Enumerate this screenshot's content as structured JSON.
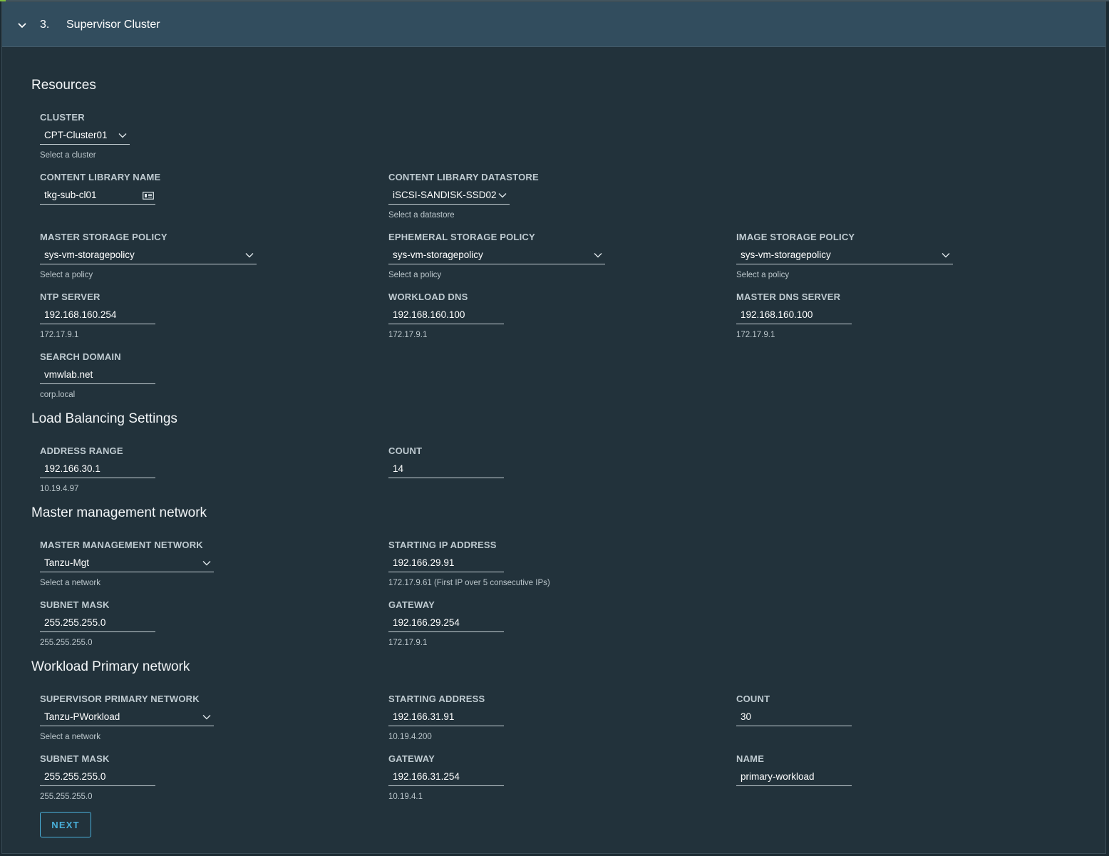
{
  "header": {
    "step": "3.",
    "title": "Supervisor Cluster"
  },
  "sections": {
    "resources": "Resources",
    "load_balancing": "Load Balancing Settings",
    "master_network": "Master management network",
    "workload_network": "Workload Primary network"
  },
  "fields": {
    "cluster": {
      "label": "CLUSTER",
      "value": "CPT-Cluster01",
      "help": "Select a cluster"
    },
    "content_library_name": {
      "label": "CONTENT LIBRARY NAME",
      "value": "tkg-sub-cl01"
    },
    "content_library_datastore": {
      "label": "CONTENT LIBRARY DATASTORE",
      "value": "iSCSI-SANDISK-SSD02",
      "help": "Select a datastore"
    },
    "master_storage_policy": {
      "label": "MASTER STORAGE POLICY",
      "value": "sys-vm-storagepolicy",
      "help": "Select a policy"
    },
    "ephemeral_storage_policy": {
      "label": "EPHEMERAL STORAGE POLICY",
      "value": "sys-vm-storagepolicy",
      "help": "Select a policy"
    },
    "image_storage_policy": {
      "label": "IMAGE STORAGE POLICY",
      "value": "sys-vm-storagepolicy",
      "help": "Select a policy"
    },
    "ntp_server": {
      "label": "NTP SERVER",
      "value": "192.168.160.254",
      "help": "172.17.9.1"
    },
    "workload_dns": {
      "label": "WORKLOAD DNS",
      "value": "192.168.160.100",
      "help": "172.17.9.1"
    },
    "master_dns_server": {
      "label": "MASTER DNS SERVER",
      "value": "192.168.160.100",
      "help": "172.17.9.1"
    },
    "search_domain": {
      "label": "SEARCH DOMAIN",
      "value": "vmwlab.net",
      "help": "corp.local"
    },
    "lb_address_range": {
      "label": "ADDRESS RANGE",
      "value": "192.166.30.1",
      "help": "10.19.4.97"
    },
    "lb_count": {
      "label": "COUNT",
      "value": "14"
    },
    "master_management_network": {
      "label": "MASTER MANAGEMENT NETWORK",
      "value": "Tanzu-Mgt",
      "help": "Select a network"
    },
    "master_starting_ip": {
      "label": "STARTING IP ADDRESS",
      "value": "192.166.29.91",
      "help": "172.17.9.61 (First IP over 5 consecutive IPs)"
    },
    "master_subnet_mask": {
      "label": "SUBNET MASK",
      "value": "255.255.255.0",
      "help": "255.255.255.0"
    },
    "master_gateway": {
      "label": "GATEWAY",
      "value": "192.166.29.254",
      "help": "172.17.9.1"
    },
    "supervisor_primary_network": {
      "label": "SUPERVISOR PRIMARY NETWORK",
      "value": "Tanzu-PWorkload",
      "help": "Select a network"
    },
    "workload_starting_address": {
      "label": "STARTING ADDRESS",
      "value": "192.166.31.91",
      "help": "10.19.4.200"
    },
    "workload_count": {
      "label": "COUNT",
      "value": "30"
    },
    "workload_subnet_mask": {
      "label": "SUBNET MASK",
      "value": "255.255.255.0",
      "help": "255.255.255.0"
    },
    "workload_gateway": {
      "label": "GATEWAY",
      "value": "192.166.31.254",
      "help": "10.19.4.1"
    },
    "workload_name": {
      "label": "NAME",
      "value": "primary-workload"
    }
  },
  "buttons": {
    "next": "NEXT"
  },
  "icons": {
    "header_toggle": "chevron-down-icon",
    "dropdown": "chevron-down-icon",
    "library": "library-card-icon"
  },
  "colors": {
    "background": "#22323b",
    "header": "#324d5e",
    "accent": "#49afd9"
  }
}
